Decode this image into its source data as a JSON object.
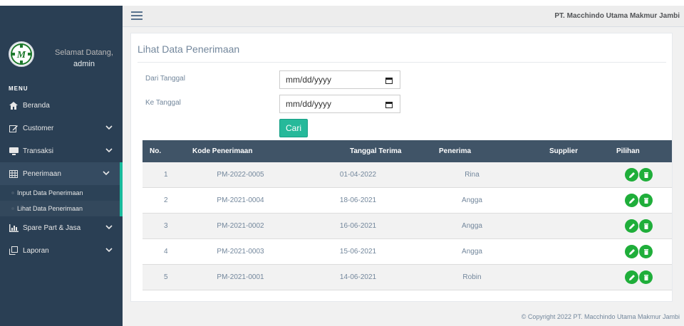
{
  "topbar": {
    "company": "PT. Macchindo Utama Makmur Jambi"
  },
  "sidebar": {
    "welcome": "Selamat Datang,",
    "username": "admin",
    "menu_title": "MENU",
    "items": [
      {
        "label": "Beranda",
        "icon": "home-icon"
      },
      {
        "label": "Customer",
        "icon": "edit-icon"
      },
      {
        "label": "Transaksi",
        "icon": "desktop-icon"
      },
      {
        "label": "Penerimaan",
        "icon": "table-icon"
      },
      {
        "label": "Spare Part & Jasa",
        "icon": "bar-chart-icon"
      },
      {
        "label": "Laporan",
        "icon": "clone-icon"
      }
    ],
    "sub_items": [
      {
        "label": "Input Data Penerimaan"
      },
      {
        "label": "Lihat Data Penerimaan"
      }
    ]
  },
  "main": {
    "title": "Lihat Data Penerimaan",
    "filter": {
      "from_label": "Dari Tanggal",
      "to_label": "Ke Tanggal",
      "from_value": "mm/dd/yyyy",
      "to_value": "mm/dd/yyyy",
      "submit_label": "Cari"
    },
    "table": {
      "headers": [
        "No.",
        "Kode Penerimaan",
        "Tanggal Terima",
        "Penerima",
        "Supplier",
        "Pilihan"
      ],
      "rows": [
        {
          "no": "1",
          "kode": "PM-2022-0005",
          "tanggal": "01-04-2022",
          "penerima": "Rina",
          "supplier": ""
        },
        {
          "no": "2",
          "kode": "PM-2021-0004",
          "tanggal": "18-06-2021",
          "penerima": "Angga",
          "supplier": ""
        },
        {
          "no": "3",
          "kode": "PM-2021-0002",
          "tanggal": "16-06-2021",
          "penerima": "Angga",
          "supplier": ""
        },
        {
          "no": "4",
          "kode": "PM-2021-0003",
          "tanggal": "15-06-2021",
          "penerima": "Angga",
          "supplier": ""
        },
        {
          "no": "5",
          "kode": "PM-2021-0001",
          "tanggal": "14-06-2021",
          "penerima": "Robin",
          "supplier": ""
        }
      ]
    }
  },
  "footer": {
    "copyright": "© Copyright 2022 PT. Macchindo Utama Makmur Jambi"
  },
  "colors": {
    "sidebar": "#2a3f54",
    "accent": "#1abb9c",
    "button": "#26b99a",
    "action": "#1fae3a",
    "table_header": "#405467"
  }
}
